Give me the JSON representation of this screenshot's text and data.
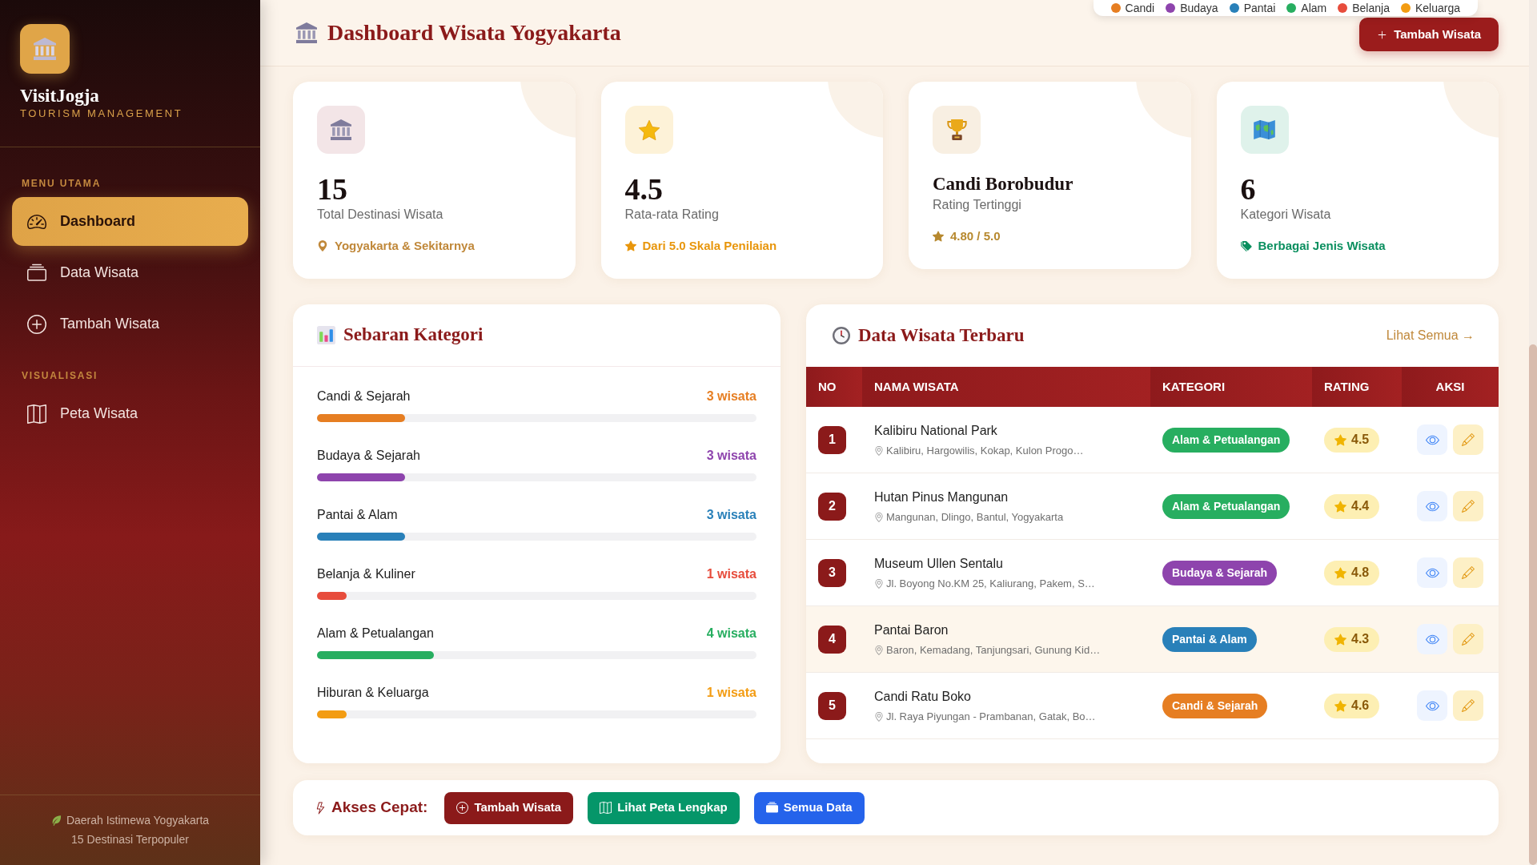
{
  "sidebar": {
    "brand": {
      "name": "VisitJogja",
      "tagline": "TOURISM MANAGEMENT"
    },
    "sections": [
      {
        "heading": "MENU UTAMA",
        "items": [
          {
            "label": "Dashboard",
            "selected": true
          },
          {
            "label": "Data Wisata",
            "selected": false
          },
          {
            "label": "Tambah Wisata",
            "selected": false
          }
        ]
      },
      {
        "heading": "VISUALISASI",
        "items": [
          {
            "label": "Peta Wisata",
            "selected": false
          }
        ]
      }
    ],
    "footer": {
      "region": "Daerah Istimewa Yogyakarta",
      "caption": "15 Destinasi Terpopuler"
    }
  },
  "header": {
    "title": "Dashboard Wisata Yogyakarta",
    "button": "Tambah Wisata"
  },
  "map_legend": [
    {
      "label": "Candi",
      "color": "#e67e22"
    },
    {
      "label": "Budaya",
      "color": "#8e44ad"
    },
    {
      "label": "Pantai",
      "color": "#2980b9"
    },
    {
      "label": "Alam",
      "color": "#27ae60"
    },
    {
      "label": "Belanja",
      "color": "#e74c3c"
    },
    {
      "label": "Keluarga",
      "color": "#f39c12"
    }
  ],
  "stats": [
    {
      "kind": "number",
      "value": "15",
      "label": "Total Destinasi Wisata",
      "note": "Yogyakarta & Sekitarnya"
    },
    {
      "kind": "number",
      "value": "4.5",
      "label": "Rata-rata Rating",
      "note": "Dari 5.0 Skala Penilaian"
    },
    {
      "kind": "name",
      "value": "Candi Borobudur",
      "label": "Rating Tertinggi",
      "note": "4.80 / 5.0"
    },
    {
      "kind": "number",
      "value": "6",
      "label": "Kategori Wisata",
      "note": "Berbagai Jenis Wisata"
    }
  ],
  "category_panel": {
    "title": "Sebaran Kategori",
    "categories": [
      {
        "name": "Candi & Sejarah",
        "count": "3 wisata",
        "level": 0.2,
        "color": "#e67e22"
      },
      {
        "name": "Budaya & Sejarah",
        "count": "3 wisata",
        "level": 0.2,
        "color": "#8e44ad"
      },
      {
        "name": "Pantai & Alam",
        "count": "3 wisata",
        "level": 0.2,
        "color": "#2980b9"
      },
      {
        "name": "Belanja & Kuliner",
        "count": "1 wisata",
        "level": 0.0667,
        "color": "#e74c3c"
      },
      {
        "name": "Alam & Petualangan",
        "count": "4 wisata",
        "level": 0.2667,
        "color": "#27ae60"
      },
      {
        "name": "Hiburan & Keluarga",
        "count": "1 wisata",
        "level": 0.0667,
        "color": "#f39c12"
      }
    ]
  },
  "latest_panel": {
    "title": "Data Wisata Terbaru",
    "link": "Lihat Semua →",
    "table": {
      "columns": [
        "NO",
        "NAMA WISATA",
        "KATEGORI",
        "RATING",
        "AKSI"
      ],
      "rows": [
        {
          "no": "1",
          "name": "Kalibiru National Park",
          "address": "Kalibiru, Hargowilis, Kokap, Kulon Progo…",
          "category": "Alam & Petualangan",
          "color": "#27ae60",
          "rating": "4.5",
          "highlighted": false
        },
        {
          "no": "2",
          "name": "Hutan Pinus Mangunan",
          "address": "Mangunan, Dlingo, Bantul, Yogyakarta",
          "category": "Alam & Petualangan",
          "color": "#27ae60",
          "rating": "4.4",
          "highlighted": false
        },
        {
          "no": "3",
          "name": "Museum Ullen Sentalu",
          "address": "Jl. Boyong No.KM 25, Kaliurang, Pakem, S…",
          "category": "Budaya & Sejarah",
          "color": "#8e44ad",
          "rating": "4.8",
          "highlighted": false
        },
        {
          "no": "4",
          "name": "Pantai Baron",
          "address": "Baron, Kemadang, Tanjungsari, Gunung Kid…",
          "category": "Pantai & Alam",
          "color": "#2980b9",
          "rating": "4.3",
          "highlighted": true
        },
        {
          "no": "5",
          "name": "Candi Ratu Boko",
          "address": "Jl. Raya Piyungan - Prambanan, Gatak, Bo…",
          "category": "Candi & Sejarah",
          "color": "#e67e22",
          "rating": "4.6",
          "highlighted": false
        }
      ]
    }
  },
  "quick_access": {
    "label": "Akses Cepat:",
    "buttons": [
      {
        "label": "Tambah Wisata"
      },
      {
        "label": "Lihat Peta Lengkap"
      },
      {
        "label": "Semua Data"
      }
    ]
  }
}
